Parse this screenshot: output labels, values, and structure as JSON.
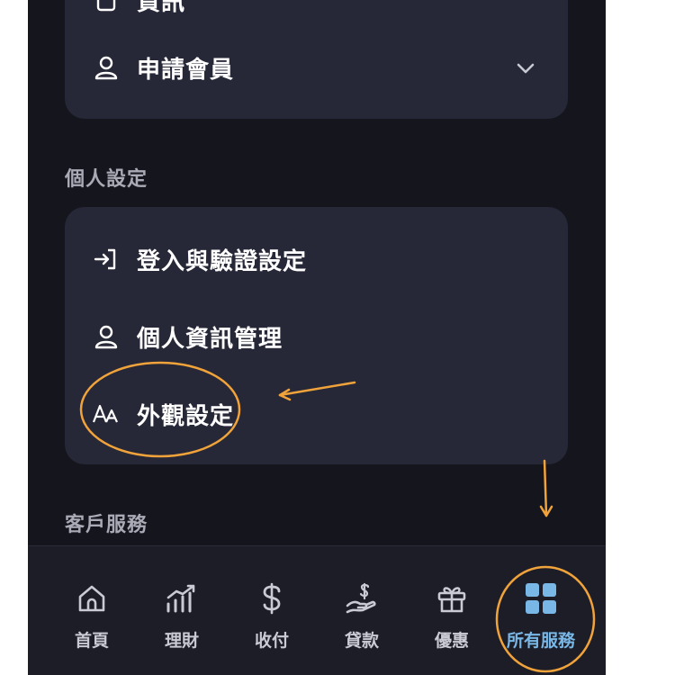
{
  "top_card": {
    "partial_label": "資訊",
    "member_label": "申請會員"
  },
  "sections": {
    "personal_title": "個人設定",
    "service_title": "客戶服務"
  },
  "personal_items": [
    {
      "label": "登入與驗證設定",
      "icon": "login-icon"
    },
    {
      "label": "個人資訊管理",
      "icon": "person-icon"
    },
    {
      "label": "外觀設定",
      "icon": "font-size-icon"
    }
  ],
  "bottom_nav": [
    {
      "label": "首頁",
      "icon": "home-icon"
    },
    {
      "label": "理財",
      "icon": "chart-icon"
    },
    {
      "label": "收付",
      "icon": "dollar-icon"
    },
    {
      "label": "貸款",
      "icon": "loan-icon"
    },
    {
      "label": "優惠",
      "icon": "gift-icon"
    },
    {
      "label": "所有服務",
      "icon": "grid-icon",
      "active": true
    }
  ],
  "colors": {
    "background": "#15151d",
    "card": "#262737",
    "active": "#78b7e6",
    "annotation": "#f0a33a"
  }
}
